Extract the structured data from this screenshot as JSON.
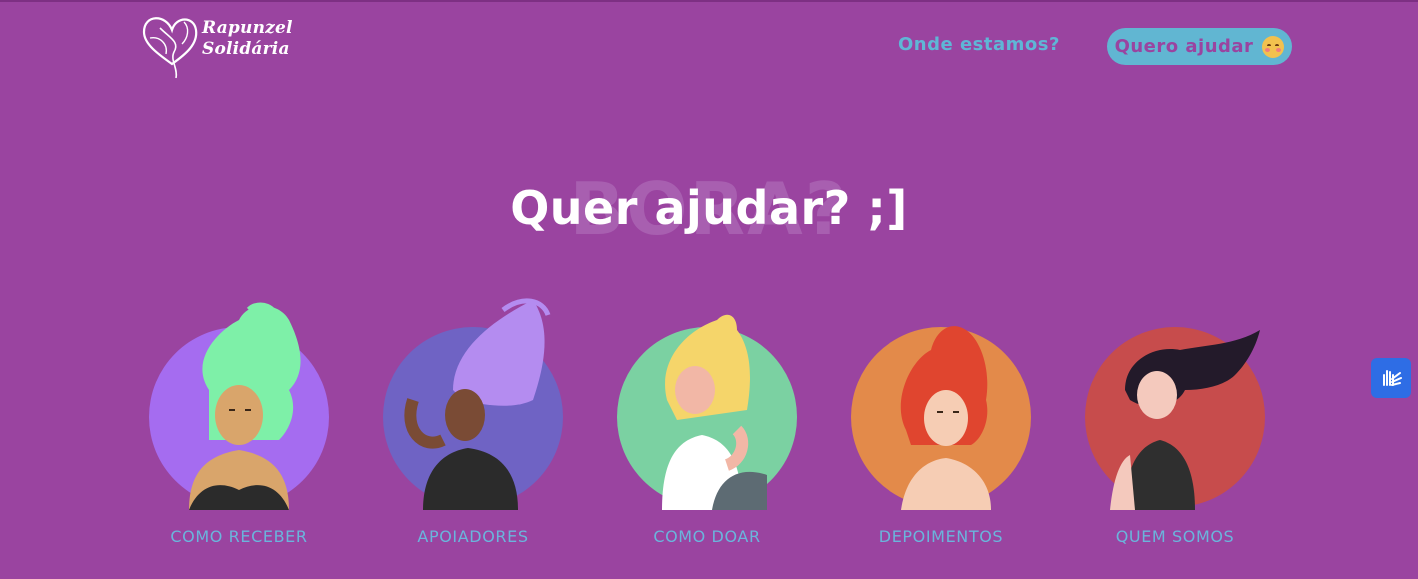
{
  "header": {
    "logo": {
      "line1": "Rapunzel",
      "line2": "Solidária"
    },
    "nav": {
      "where_label": "Onde estamos?"
    },
    "cta": {
      "label": "Quero ajudar",
      "icon": "smiling-face-with-hearts-icon"
    }
  },
  "hero": {
    "ghost_text": "BORA?",
    "title": "Quer ajudar? ;]"
  },
  "cards": [
    {
      "label": "COMO RECEBER",
      "bg": "#a56cf0",
      "hair": "#7ef0a8",
      "skin": "#d9a56b"
    },
    {
      "label": "APOIADORES",
      "bg": "#6f63c4",
      "hair": "#b48cf0",
      "skin": "#7a4b35"
    },
    {
      "label": "COMO DOAR",
      "bg": "#7bd1a2",
      "hair": "#f5d56a",
      "skin": "#f2b7a6"
    },
    {
      "label": "DEPOIMENTOS",
      "bg": "#e38a4a",
      "hair": "#e0452f",
      "skin": "#f6cdb4"
    },
    {
      "label": "QUEM SOMOS",
      "bg": "#c74c4c",
      "hair": "#231a2a",
      "skin": "#f4c9bd"
    }
  ],
  "accessibility": {
    "icon": "sign-language-hands-icon"
  },
  "colors": {
    "background": "#9a44a0",
    "accent": "#61b6d2",
    "label": "#6ab5dc"
  }
}
